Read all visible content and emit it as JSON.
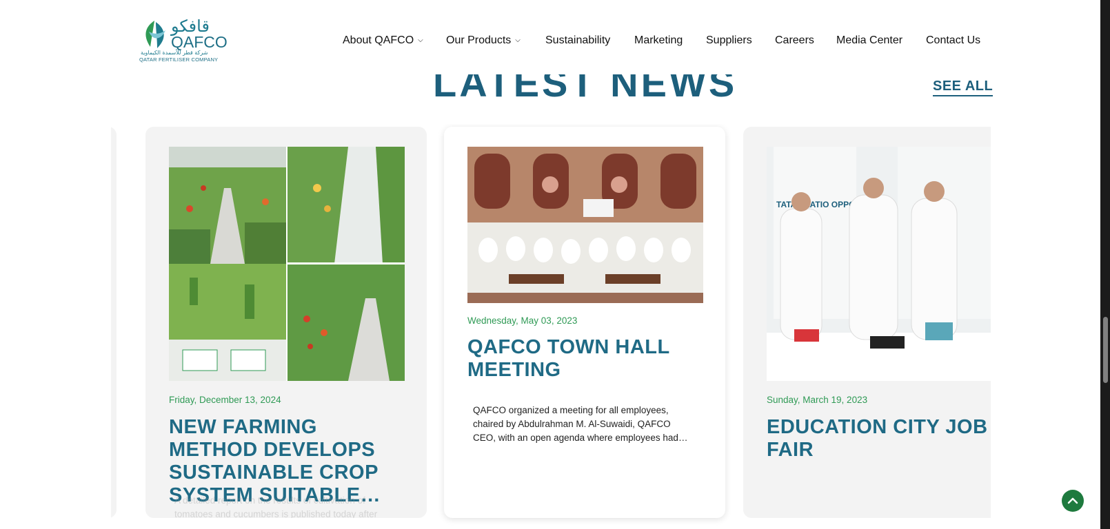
{
  "header": {
    "logo": {
      "arabic": "قافكو",
      "name": "QAFCO",
      "arabic_subtitle": "شركة قطر للأسمدة الكيماوية",
      "subtitle": "QATAR FERTILISER COMPANY"
    },
    "nav": [
      {
        "label": "About QAFCO",
        "dropdown": true
      },
      {
        "label": "Our Products",
        "dropdown": true
      },
      {
        "label": "Sustainability",
        "dropdown": false
      },
      {
        "label": "Marketing",
        "dropdown": false
      },
      {
        "label": "Suppliers",
        "dropdown": false
      },
      {
        "label": "Careers",
        "dropdown": false
      },
      {
        "label": "Media Center",
        "dropdown": false
      },
      {
        "label": "Contact Us",
        "dropdown": false
      }
    ]
  },
  "news": {
    "heading": "LATEST NEWS",
    "see_all": "SEE ALL",
    "cards": [
      {
        "date": "Friday, December 13, 2024",
        "title": "NEW FARMING METHOD DEVELOPS SUSTAINABLE CROP SYSTEM SUITABLE…",
        "excerpt": "A detailed report on the results of cultivation of tomatoes and cucumbers is published today after"
      },
      {
        "date": "Wednesday, May 03, 2023",
        "title": "QAFCO TOWN HALL MEETING",
        "excerpt": "QAFCO organized a meeting for all employees, chaired by Abdulrahman M. Al-Suwaidi, QAFCO CEO, with an open agenda where employees had…"
      },
      {
        "date": "Sunday, March 19, 2023",
        "title": "EDUCATION CITY JOB FAIR",
        "image_text": "TATARIZATIO OPPORTUNI"
      }
    ]
  },
  "icons": {
    "scroll_top": "chevron-up-icon",
    "dropdown": "chevron-down-icon"
  },
  "colors": {
    "brand_blue": "#1d5f7c",
    "date_green": "#2f9a55",
    "scroll_button": "#1e7a3e",
    "card_bg": "#f3f3f3"
  }
}
